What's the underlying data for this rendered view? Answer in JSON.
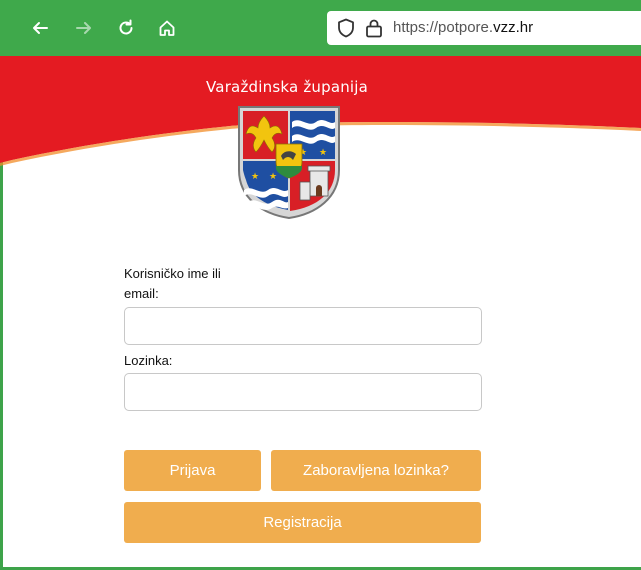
{
  "browser": {
    "back_icon": "arrow-left-icon",
    "forward_icon": "arrow-right-icon",
    "reload_icon": "reload-icon",
    "home_icon": "home-icon",
    "url_prefix": "https://potpore.",
    "url_domain": "vzz.hr",
    "toolbar_color": "#3fa94b"
  },
  "header": {
    "county_name": "Varaždinska županija",
    "banner_color": "#e41b22"
  },
  "form": {
    "username_label_line1": "Korisničko ime ili",
    "username_label_line2": "email:",
    "username_value": "",
    "password_label": "Lozinka:",
    "password_value": ""
  },
  "buttons": {
    "login": "Prijava",
    "forgot_password": "Zaboravljena lozinka?",
    "register": "Registracija",
    "color": "#f0ad4e"
  }
}
